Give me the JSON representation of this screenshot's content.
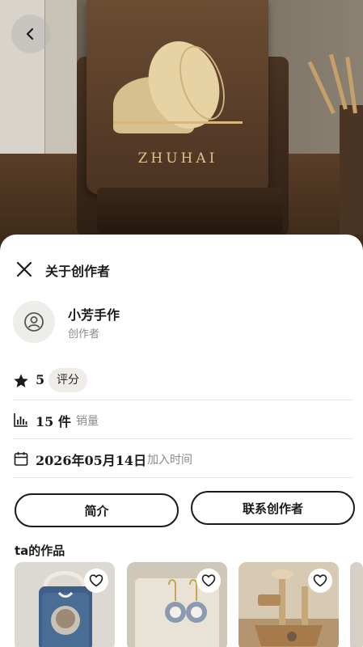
{
  "hero": {
    "engraving": "ZHUHAI"
  },
  "sheet": {
    "title": "关于创作者"
  },
  "creator": {
    "name": "小芳手作",
    "role": "创作者"
  },
  "stats": {
    "rating": {
      "value": "5",
      "label": "评分"
    },
    "sales": {
      "value": "15 件",
      "label": "销量"
    },
    "joined": {
      "value": "2026年05月14日",
      "label": "加入时间"
    }
  },
  "actions": {
    "intro_label": "简介",
    "contact_label": "联系创作者"
  },
  "works": {
    "title": "ta的作品",
    "items": [
      {
        "name": "denim-cat-bag",
        "icon": "heart-icon"
      },
      {
        "name": "cat-earrings",
        "icon": "heart-icon"
      },
      {
        "name": "cat-tree",
        "icon": "heart-icon"
      }
    ]
  },
  "icons": {
    "back": "chevron-left-icon",
    "close": "close-icon",
    "avatar": "user-circle-icon",
    "rating": "star-icon",
    "sales": "bar-chart-icon",
    "joined": "calendar-icon"
  }
}
